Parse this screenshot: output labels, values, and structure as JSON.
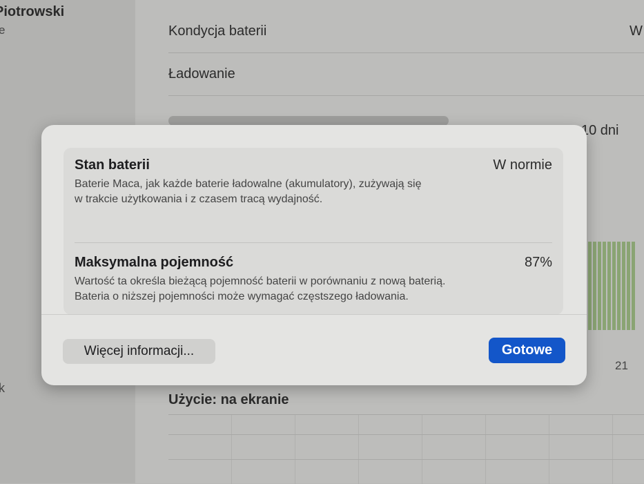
{
  "sidebar": {
    "user_name": "Piotrowski",
    "fragment_top": "e",
    "fragment_bottom": "k"
  },
  "settings": {
    "battery_health_label": "Kondycja baterii",
    "battery_health_value_fragment": "W",
    "charging_label": "Ładowanie",
    "segment_right_label": "10 dni",
    "chart_tick": "21",
    "usage_title": "Użycie: na ekranie"
  },
  "dialog": {
    "status": {
      "title": "Stan baterii",
      "value": "W normie",
      "description_line1": "Baterie Maca, jak każde baterie ładowalne (akumulatory), zużywają się",
      "description_line2": "w trakcie użytkowania i z czasem tracą wydajność."
    },
    "capacity": {
      "title": "Maksymalna pojemność",
      "value": "87%",
      "description_line1": "Wartość ta określa bieżącą pojemność baterii w porównaniu z nową baterią.",
      "description_line2": "Bateria o niższej pojemności może wymagać częstszego ładowania."
    },
    "more_info_button": "Więcej informacji...",
    "done_button": "Gotowe"
  },
  "colors": {
    "primary_button": "#1356c9",
    "chart_bar": "#8aa473"
  }
}
